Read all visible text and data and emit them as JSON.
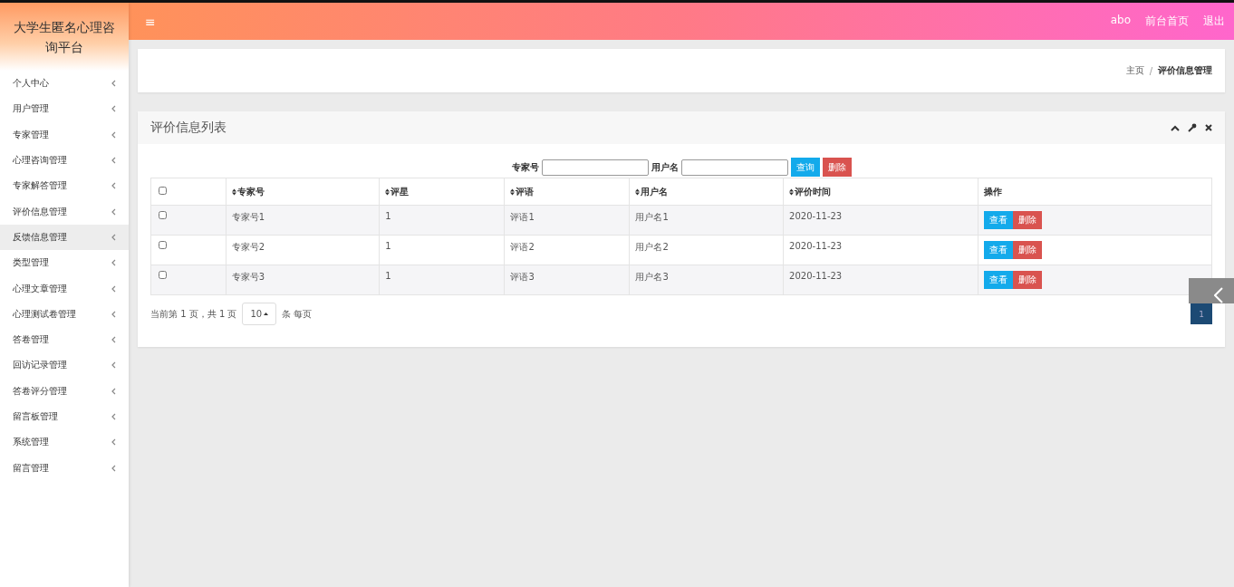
{
  "sidebar": {
    "title": "大学生匿名心理咨询平台",
    "items": [
      {
        "label": "个人中心",
        "selected": false
      },
      {
        "label": "用户管理",
        "selected": false
      },
      {
        "label": "专家管理",
        "selected": false
      },
      {
        "label": "心理咨询管理",
        "selected": false
      },
      {
        "label": "专家解答管理",
        "selected": false
      },
      {
        "label": "评价信息管理",
        "selected": false
      },
      {
        "label": "反馈信息管理",
        "selected": true
      },
      {
        "label": "类型管理",
        "selected": false
      },
      {
        "label": "心理文章管理",
        "selected": false
      },
      {
        "label": "心理测试卷管理",
        "selected": false
      },
      {
        "label": "答卷管理",
        "selected": false
      },
      {
        "label": "回访记录管理",
        "selected": false
      },
      {
        "label": "答卷评分管理",
        "selected": false
      },
      {
        "label": "留言板管理",
        "selected": false
      },
      {
        "label": "系统管理",
        "selected": false
      },
      {
        "label": "留言管理",
        "selected": false
      }
    ]
  },
  "header": {
    "menu_glyph": "≡",
    "user": "abo",
    "links": [
      "前台首页",
      "退出"
    ]
  },
  "breadcrumb": [
    "主页",
    "/",
    "评价信息管理"
  ],
  "panel": {
    "title": "评价信息列表",
    "search": [
      {
        "label": "专家号"
      },
      {
        "label": "用户名"
      }
    ],
    "search_buttons": [
      {
        "label": "查询",
        "kind": "primary"
      },
      {
        "label": "删除",
        "kind": "danger"
      }
    ],
    "select_all": {
      "checked": false
    },
    "columns": [
      {
        "label": "专家号",
        "kind": "sort"
      },
      {
        "label": "评星",
        "kind": "sort"
      },
      {
        "label": "评语",
        "kind": "sort"
      },
      {
        "label": "用户名",
        "kind": "sort"
      },
      {
        "label": "评价时间",
        "kind": "sort"
      },
      {
        "label": "操作",
        "kind": "plain"
      }
    ],
    "rows": [
      {
        "checked": false,
        "cells": [
          "专家号1",
          "1",
          "评语1",
          "用户名1",
          "2020-11-23"
        ],
        "actions": [
          "查看",
          "删除"
        ]
      },
      {
        "checked": false,
        "cells": [
          "专家号2",
          "1",
          "评语2",
          "用户名2",
          "2020-11-23"
        ],
        "actions": [
          "查看",
          "删除"
        ]
      },
      {
        "checked": false,
        "cells": [
          "专家号3",
          "1",
          "评语3",
          "用户名3",
          "2020-11-23"
        ],
        "actions": [
          "查看",
          "删除"
        ]
      }
    ],
    "pagination": {
      "info": "当前第 1 页，共 1 页",
      "page_size": "10",
      "size_suffix": "条 每页",
      "pages": [
        {
          "label": "1",
          "selected": true
        }
      ]
    }
  }
}
